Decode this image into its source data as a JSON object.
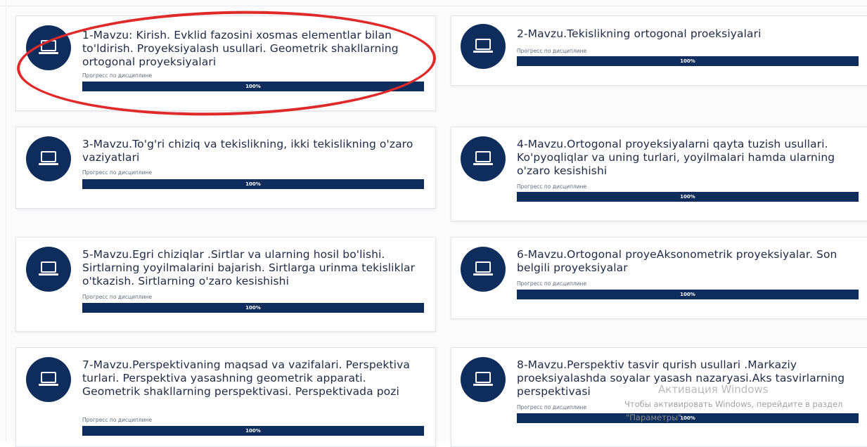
{
  "progress_label": "Прогресс по дисциплине",
  "colors": {
    "accent": "#0e2d5c",
    "annotation": "#e02929"
  },
  "topic_icon": "laptop-icon",
  "topics": [
    {
      "title": "1-Mavzu: Kirish. Evklid fazosini xosmas elementlar bilan to'ldirish. Proyeksiyalash usullari. Geometrik shakllarning ortogonal proyeksiyalari",
      "progress_text": "100%",
      "progress": 1.0
    },
    {
      "title": "2-Mavzu.Tekislikning ortogonal proeksiyalari",
      "progress_text": "100%",
      "progress": 1.0
    },
    {
      "title": "3-Mavzu.To'g'ri chiziq va tekislikning, ikki tekislikning o'zaro vaziyatlari",
      "progress_text": "100%",
      "progress": 1.0
    },
    {
      "title": "4-Mavzu.Ortogonal proyeksiyalarni qayta tuzish usullari. Ko'pyoqliqlar va uning turlari, yoyilmalari hamda ularning o'zaro kesishishi",
      "progress_text": "100%",
      "progress": 1.0
    },
    {
      "title": "5-Mavzu.Egri chiziqlar .Sirtlar va ularning hosil bo'lishi. Sirtlarning yoyilmalarini bajarish. Sirtlarga urinma tekisliklar o'tkazish. Sirtlarning o'zaro kesishishi",
      "progress_text": "100%",
      "progress": 1.0
    },
    {
      "title": "6-Mavzu.Ortogonal proyeAksonometrik proyeksiyalar. Son belgili proyeksiyalar",
      "progress_text": "100%",
      "progress": 1.0
    },
    {
      "title": "7-Mavzu.Perspektivaning maqsad va vazifalari. Perspektiva turlari. Perspektiva yasashning geometrik apparati. Geometrik shakllarning perspektivasi. Perspektivada pozi",
      "progress_text": "100%",
      "progress": 1.0
    },
    {
      "title": "8-Mavzu.Perspektiv tasvir qurish usullari .Markaziy proeksiyalashda soyalar yasash nazaryasi.Aks tasvirlarning perspektivasi",
      "progress_text": "100%",
      "progress": 1.0
    }
  ],
  "windows_watermark": {
    "title": "Активация Windows",
    "subtitle": "Чтобы активировать Windows, перейдите в раздел",
    "link": "\"Параметры\"."
  }
}
